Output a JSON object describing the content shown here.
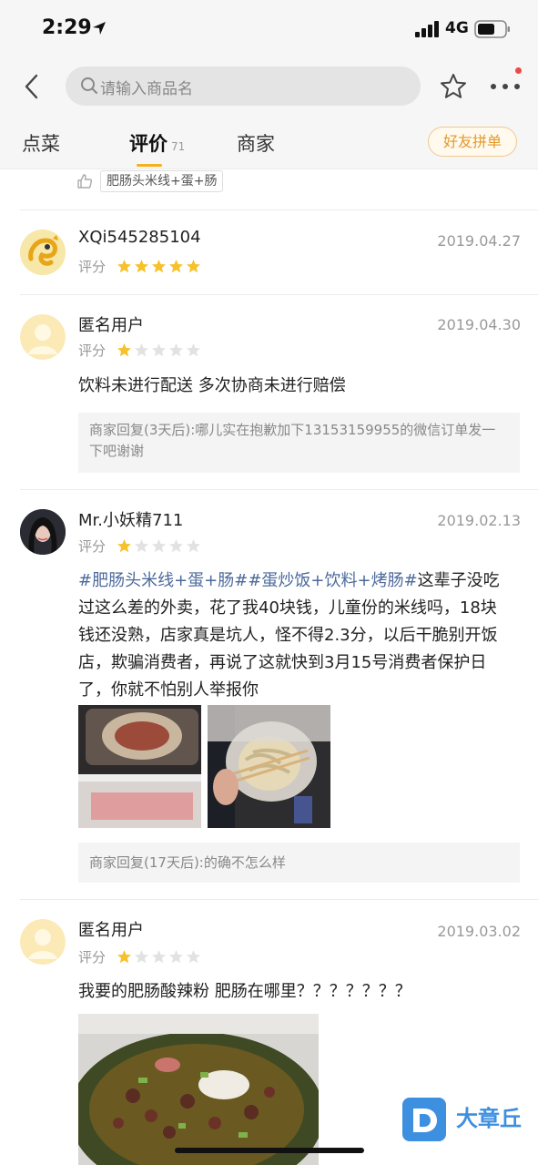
{
  "status": {
    "time": "2:29",
    "network": "4G"
  },
  "search": {
    "placeholder": "请输入商品名"
  },
  "tabs": [
    {
      "label": "点菜"
    },
    {
      "label": "评价",
      "count": "71"
    },
    {
      "label": "商家"
    }
  ],
  "group_button": "好友拼单",
  "top_tag": "肥肠头米线+蛋+肠",
  "rating_label": "评分",
  "reviews": [
    {
      "user": "XQi545285104",
      "date": "2019.04.27",
      "stars": 5
    },
    {
      "user": "匿名用户",
      "date": "2019.04.30",
      "stars": 1,
      "text": "饮料未进行配送  多次协商未进行赔偿",
      "reply": "商家回复(3天后):哪儿实在抱歉加下13153159955的微信订单发一下吧谢谢"
    },
    {
      "user": "Mr.小妖精711",
      "date": "2019.02.13",
      "stars": 1,
      "hashtags": "#肥肠头米线+蛋+肠##蛋炒饭+饮料+烤肠#",
      "text": "这辈子没吃过这么差的外卖，花了我40块钱，儿童份的米线吗，18块钱还没熟，店家真是坑人，怪不得2.3分，以后干脆别开饭店，欺骗消费者，再说了这就快到3月15号消费者保护日了，你就不怕别人举报你",
      "reply": "商家回复(17天后):的确不怎么样"
    },
    {
      "user": "匿名用户",
      "date": "2019.03.02",
      "stars": 1,
      "text": "我要的肥肠酸辣粉  肥肠在哪里？？？？？？？"
    }
  ],
  "watermark": "大章丘",
  "colors": {
    "accent": "#f5b01d",
    "star_on": "#f7c12b",
    "star_off": "#e2e2e2",
    "hashtag": "#4c6a9c"
  }
}
